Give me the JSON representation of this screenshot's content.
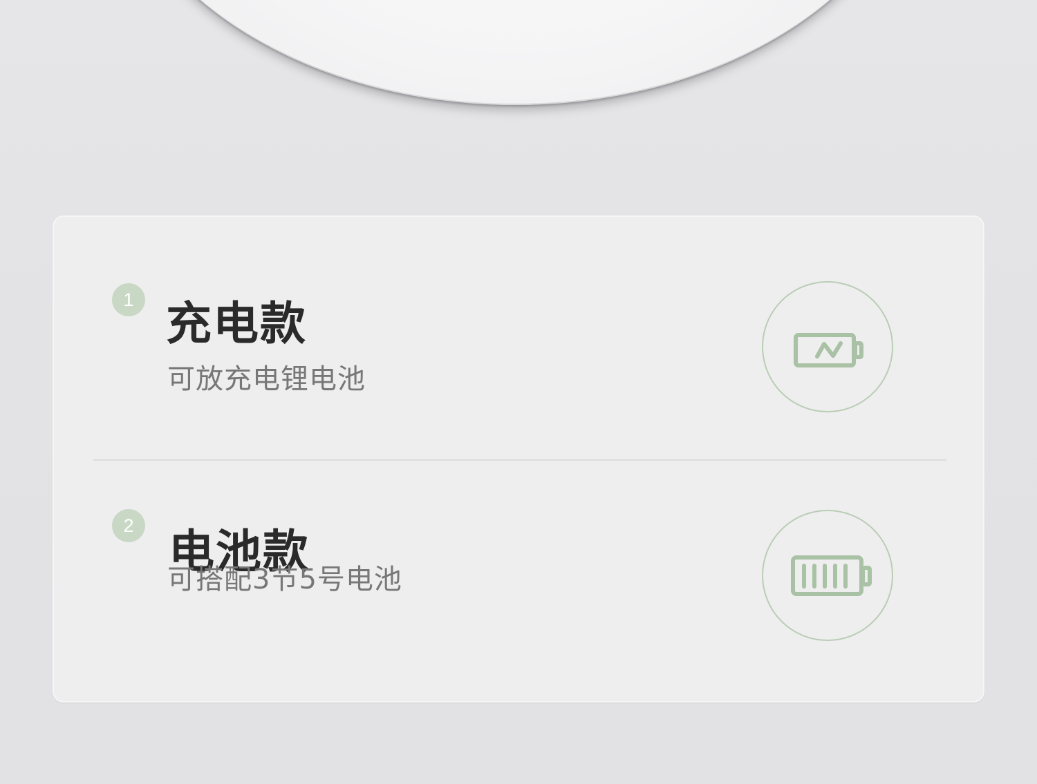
{
  "options": [
    {
      "number": "1",
      "title": "充电款",
      "subtitle": "可放充电锂电池",
      "icon": "charging-battery-icon"
    },
    {
      "number": "2",
      "title": "电池款",
      "subtitle": "可搭配3节5号电池",
      "icon": "full-battery-icon"
    }
  ],
  "colors": {
    "accent": "#c8d8c4",
    "icon_stroke": "#a9c1a4",
    "title": "#2a2a2a",
    "subtitle": "#777777",
    "background": "#e4e4e6",
    "card": "#efeeef"
  }
}
